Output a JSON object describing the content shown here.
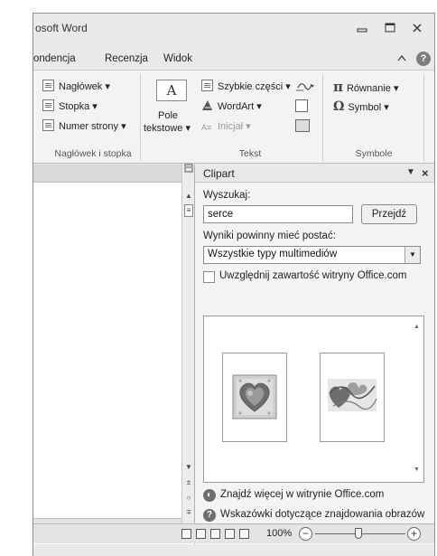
{
  "window": {
    "title": "osoft Word",
    "minimize_icon": "minimize-icon",
    "maximize_icon": "maximize-icon",
    "close_icon": "close-icon"
  },
  "tabs": [
    {
      "label": "ondencja"
    },
    {
      "label": "Recenzja"
    },
    {
      "label": "Widok"
    }
  ],
  "ribbon": {
    "header_footer": {
      "items": [
        {
          "label": "Nagłówek ▾",
          "icon": "header-icon"
        },
        {
          "label": "Stopka ▾",
          "icon": "footer-icon"
        },
        {
          "label": "Numer strony ▾",
          "icon": "page-number-icon"
        }
      ],
      "group_label": "Nagłówek i stopka"
    },
    "text": {
      "textbox_icon_text": "A",
      "textbox_label_line1": "Pole",
      "textbox_label_line2": "tekstowe ▾",
      "items": [
        {
          "label": "Szybkie części ▾",
          "icon": "quick-parts-icon"
        },
        {
          "label": "WordArt ▾",
          "icon": "wordart-icon"
        },
        {
          "label": "Inicjał ▾",
          "icon": "drop-cap-icon",
          "disabled": true
        }
      ],
      "group_label": "Tekst"
    },
    "symbols": {
      "items": [
        {
          "label": "Równanie ▾",
          "icon": "pi-icon",
          "glyph": "π"
        },
        {
          "label": "Symbol ▾",
          "icon": "omega-icon",
          "glyph": "Ω"
        }
      ],
      "group_label": "Symbole"
    }
  },
  "clipart_pane": {
    "title": "Clipart",
    "search_label": "Wyszukaj:",
    "search_value": "serce",
    "go_button": "Przejdź",
    "results_label": "Wyniki powinny mieć postać:",
    "media_type_value": "Wszystkie typy multimediów",
    "include_office_label": "Uwzględnij zawartość witryny Office.com",
    "include_office_checked": false,
    "results": [
      {
        "name": "heart-clipart-1",
        "icon": "heart-image"
      },
      {
        "name": "heart-clipart-2",
        "icon": "hearts-abstract-image"
      }
    ],
    "more_link": "Znajdź więcej w witrynie Office.com",
    "tips_link": "Wskazówki dotyczące znajdowania obrazów"
  },
  "status_bar": {
    "zoom_label": "100%",
    "zoom_percent": 100
  },
  "colors": {
    "chrome": "#e9e9e9",
    "ribbon": "#f3f3f3",
    "pane": "#f4f4f4"
  }
}
